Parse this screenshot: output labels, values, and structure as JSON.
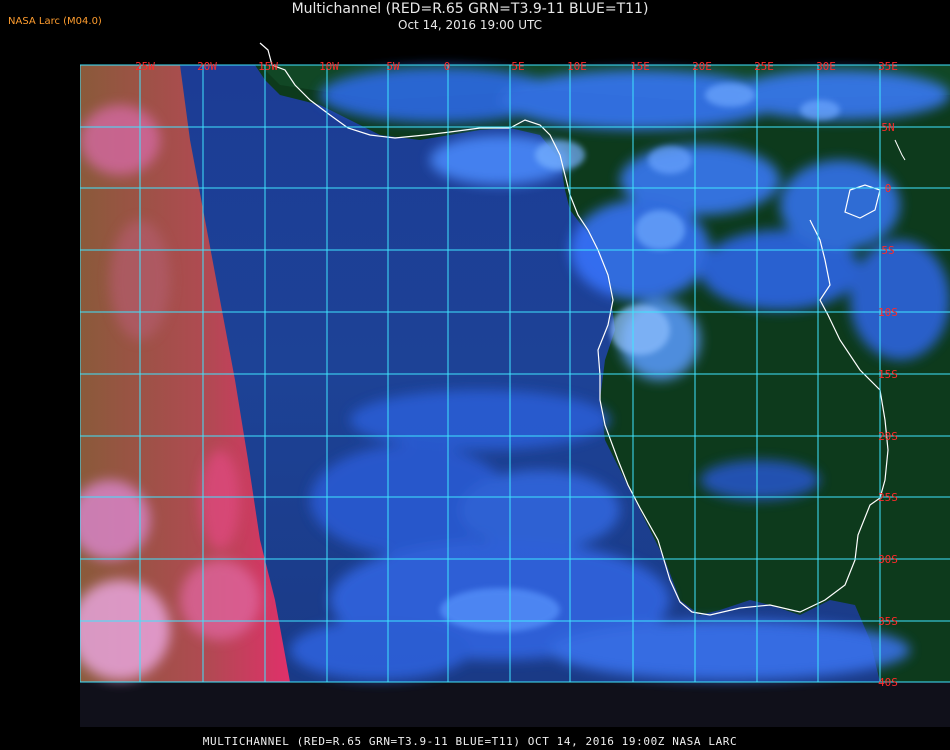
{
  "header": {
    "agency_tag": "NASA Larc (M04.0)",
    "title": "Multichannel (RED=R.65 GRN=T3.9-11 BLUE=T11)",
    "subtitle": "Oct 14, 2016 19:00 UTC"
  },
  "footer": {
    "caption": "MULTICHANNEL (RED=R.65 GRN=T3.9-11 BLUE=T11) OCT 14, 2016 19:00Z    NASA LARC"
  },
  "map": {
    "longitude_labels": [
      "25W",
      "20W",
      "15W",
      "10W",
      "5W",
      "0",
      "5E",
      "10E",
      "15E",
      "20E",
      "25E",
      "30E",
      "35E"
    ],
    "latitude_labels": [
      "5N",
      "0",
      "5S",
      "10S",
      "15S",
      "20S",
      "25S",
      "30S",
      "35S",
      "40S"
    ],
    "colors": {
      "grid": "#35e0ff",
      "lon_label": "#ff2a2a",
      "lat_label": "#ff2a2a",
      "coastline": "#ffffff",
      "ocean": "#1b3f8a",
      "land": "#0c3618",
      "cloud": "#3f7dff",
      "night_region": "#c43a60"
    }
  }
}
